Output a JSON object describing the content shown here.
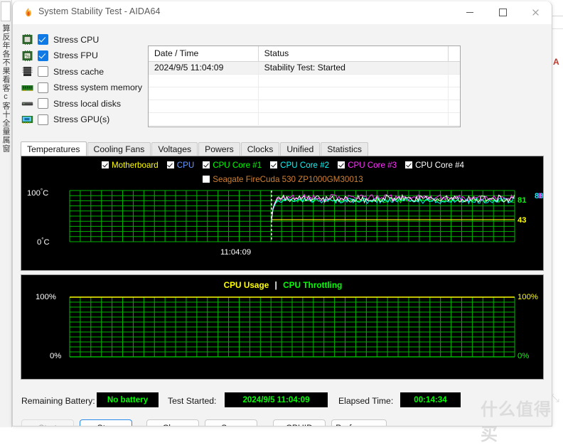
{
  "background": {
    "left_rail_text": "算反年各不果看客c客十全量属窗",
    "right_letter": "A",
    "right_mark": "⤡",
    "watermark": "什么值得买"
  },
  "window": {
    "title": "System Stability Test - AIDA64",
    "icon": "flame-icon",
    "controls": {
      "minimize": "—",
      "maximize": "□",
      "close": "✕"
    }
  },
  "stress_options": [
    {
      "label": "Stress CPU",
      "checked": true,
      "icon": "cpu-chip-icon"
    },
    {
      "label": "Stress FPU",
      "checked": true,
      "icon": "fpu-percent-chip-icon"
    },
    {
      "label": "Stress cache",
      "checked": false,
      "icon": "cache-module-icon"
    },
    {
      "label": "Stress system memory",
      "checked": false,
      "icon": "memory-dimm-icon"
    },
    {
      "label": "Stress local disks",
      "checked": false,
      "icon": "hard-disk-icon"
    },
    {
      "label": "Stress GPU(s)",
      "checked": false,
      "icon": "gpu-card-icon"
    }
  ],
  "status_grid": {
    "columns": [
      "Date / Time",
      "Status",
      ""
    ],
    "rows": [
      [
        "2024/9/5 11:04:09",
        "Stability Test: Started",
        ""
      ],
      [
        "",
        "",
        ""
      ],
      [
        "",
        "",
        ""
      ],
      [
        "",
        "",
        ""
      ],
      [
        "",
        "",
        ""
      ]
    ]
  },
  "tabs": [
    {
      "label": "Temperatures",
      "active": true
    },
    {
      "label": "Cooling Fans",
      "active": false
    },
    {
      "label": "Voltages",
      "active": false
    },
    {
      "label": "Powers",
      "active": false
    },
    {
      "label": "Clocks",
      "active": false
    },
    {
      "label": "Unified",
      "active": false
    },
    {
      "label": "Statistics",
      "active": false
    }
  ],
  "chart_data": [
    {
      "type": "line",
      "name": "temperatures",
      "title": "",
      "ylabel": "",
      "ylim": [
        0,
        100
      ],
      "y_ticks": [
        {
          "value": 100,
          "label": "100°C"
        },
        {
          "value": 0,
          "label": "0°C"
        }
      ],
      "x_ticks": [
        {
          "label": "11:04:09",
          "pos": 0.455
        }
      ],
      "grid": true,
      "grid_color": "#00b400",
      "background": "#000000",
      "legend_position": "top",
      "start_marker": {
        "label": "11:04:09",
        "style": "white-dashed-vertical"
      },
      "legend": [
        {
          "label": "Motherboard",
          "color": "#ffff00",
          "checked": true
        },
        {
          "label": "CPU",
          "color": "#6699ff",
          "checked": true
        },
        {
          "label": "CPU Core #1",
          "color": "#00ff00",
          "checked": true
        },
        {
          "label": "CPU Core #2",
          "color": "#00ffff",
          "checked": true
        },
        {
          "label": "CPU Core #3",
          "color": "#ff33ff",
          "checked": true
        },
        {
          "label": "CPU Core #4",
          "color": "#ffffff",
          "checked": true
        },
        {
          "label": "Seagate FireCuda 530 ZP1000GM30013",
          "color": "#d08030",
          "checked": false
        }
      ],
      "current_values": [
        {
          "label": "81",
          "color": "#00ff00",
          "series": "CPU Core #1"
        },
        {
          "label": "88",
          "color": "#00ffff",
          "series": "CPU Core #2"
        },
        {
          "label": "86",
          "color": "#ff33ff",
          "series": "CPU Core #3"
        },
        {
          "label": "43",
          "color": "#ffff00",
          "series": "Motherboard"
        }
      ],
      "series": [
        {
          "name": "Motherboard",
          "color": "#ffff00",
          "value": 43,
          "style": "flat"
        },
        {
          "name": "CPU Core #1",
          "color": "#00ff00",
          "value": 81,
          "style": "noisy"
        },
        {
          "name": "CPU Core #2",
          "color": "#00ffff",
          "value": 80,
          "style": "noisy"
        },
        {
          "name": "CPU Core #3",
          "color": "#ff33ff",
          "value": 86,
          "style": "noisy"
        },
        {
          "name": "CPU Core #4",
          "color": "#ffffff",
          "value": 84,
          "style": "noisy"
        }
      ]
    },
    {
      "type": "line",
      "name": "cpu-usage",
      "title_parts": [
        {
          "text": "CPU Usage",
          "color": "#ffff00"
        },
        {
          "text": "|",
          "color": "#ffffff"
        },
        {
          "text": "CPU Throttling",
          "color": "#00ff00"
        }
      ],
      "ylim": [
        0,
        100
      ],
      "y_ticks_left": [
        {
          "value": 100,
          "label": "100%",
          "color": "#ffffff"
        },
        {
          "value": 0,
          "label": "0%",
          "color": "#ffffff"
        }
      ],
      "y_ticks_right": [
        {
          "value": 100,
          "label": "100%",
          "color": "#ffff00"
        },
        {
          "value": 0,
          "label": "0%",
          "color": "#00ff00"
        }
      ],
      "grid": true,
      "grid_color": "#00b400",
      "background": "#000000",
      "series": [
        {
          "name": "CPU Usage",
          "color": "#ffff00",
          "value": 100,
          "style": "flat"
        },
        {
          "name": "CPU Throttling",
          "color": "#00ff00",
          "value": 0,
          "style": "flat"
        }
      ]
    }
  ],
  "footer": {
    "battery_label": "Remaining Battery:",
    "battery_value": "No battery",
    "battery_color": "#00ff00",
    "started_label": "Test Started:",
    "started_value": "2024/9/5 11:04:09",
    "started_color": "#00ff00",
    "elapsed_label": "Elapsed Time:",
    "elapsed_value": "00:14:34",
    "elapsed_color": "#00ff00",
    "buttons": [
      {
        "label": "Start",
        "state": "disabled"
      },
      {
        "label": "Stop",
        "state": "focused"
      },
      {
        "label": "Clear",
        "state": "normal"
      },
      {
        "label": "Save",
        "state": "normal"
      },
      {
        "label": "CPUID",
        "state": "normal"
      },
      {
        "label": "Preferences",
        "state": "normal"
      }
    ]
  }
}
